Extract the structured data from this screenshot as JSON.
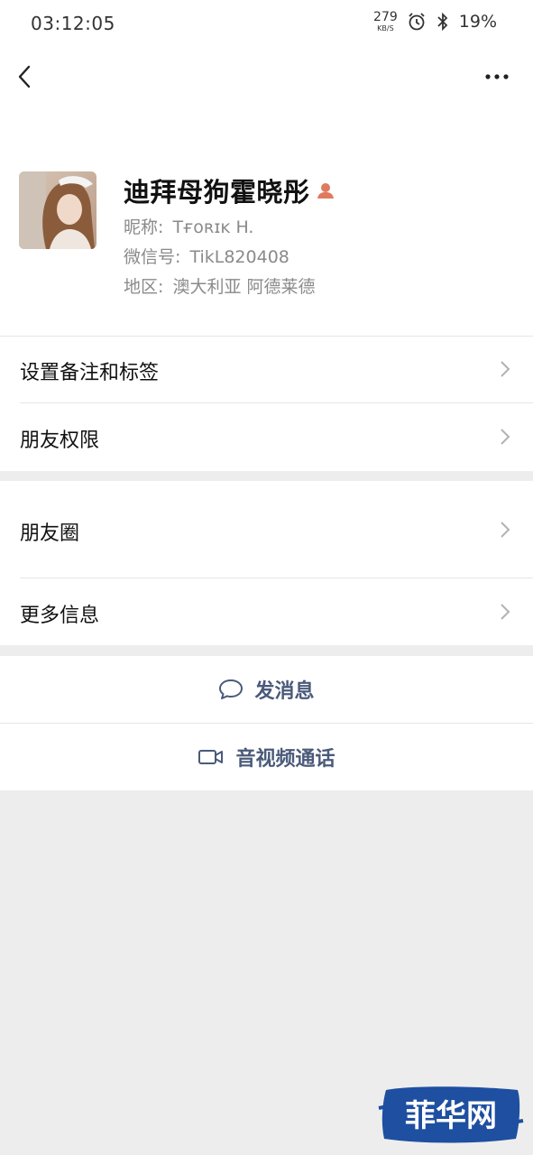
{
  "status_bar": {
    "time": "03:12:05",
    "net_speed_value": "279",
    "net_speed_unit": "KB/S",
    "battery": "19%"
  },
  "profile": {
    "name": "迪拜母狗霍晓彤",
    "nickname_label": "昵称:",
    "nickname": "Tғᴏʀɪᴋ  H.",
    "wechat_label": "微信号:",
    "wechat_id": "TikL820408",
    "region_label": "地区:",
    "region": "澳大利亚  阿德莱德"
  },
  "menu": {
    "remark_tags": "设置备注和标签",
    "friend_permissions": "朋友权限",
    "moments": "朋友圈",
    "more_info": "更多信息"
  },
  "actions": {
    "send_message": "发消息",
    "video_call": "音视频通话"
  },
  "watermark": {
    "text": "菲华网"
  },
  "colors": {
    "accent_text": "#4a5a7a",
    "background": "#ededed",
    "gender_icon": "#e07a5f",
    "watermark_blue": "#1e4fa0"
  }
}
